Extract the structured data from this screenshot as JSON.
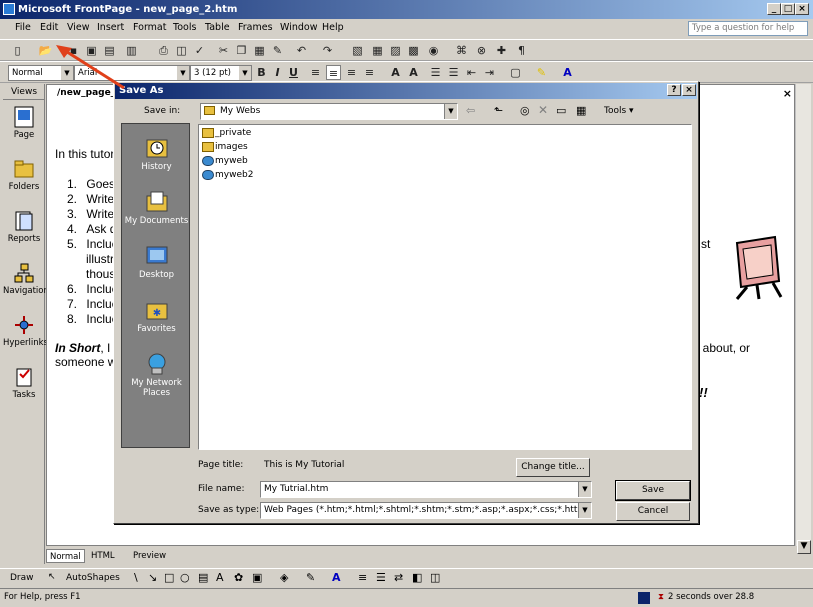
{
  "window": {
    "title": "Microsoft FrontPage - new_page_2.htm"
  },
  "menu": {
    "items": [
      "File",
      "Edit",
      "View",
      "Insert",
      "Format",
      "Tools",
      "Table",
      "Frames",
      "Window",
      "Help"
    ],
    "help_placeholder": "Type a question for help"
  },
  "format_toolbar": {
    "style": "Normal",
    "font": "Arial",
    "size": "3  (12 pt)"
  },
  "views": {
    "header": "Views",
    "items": [
      "Page",
      "Folders",
      "Reports",
      "Navigation",
      "Hyperlinks",
      "Tasks"
    ]
  },
  "document": {
    "tab": "new_page_2",
    "intro": "In this tutor",
    "list": [
      {
        "num": "1.",
        "text": "Goes"
      },
      {
        "num": "2.",
        "text": "Write"
      },
      {
        "num": "3.",
        "text": "Write"
      },
      {
        "num": "4.",
        "text": "Ask q"
      },
      {
        "num": "5.",
        "text": "Incluc"
      },
      {
        "num": "",
        "text": "illustr"
      },
      {
        "num": "",
        "text": "thous"
      },
      {
        "num": "6.",
        "text": "Incluc"
      },
      {
        "num": "7.",
        "text": "Incluc"
      },
      {
        "num": "8.",
        "text": "Incluc"
      }
    ],
    "in_short_bold": "In Short",
    "in_short_rest": ", I",
    "someone": "someone w",
    "right_st": "st",
    "right_line": "ng about, or",
    "right_bang": "!!"
  },
  "bottom_tabs": [
    "Normal",
    "HTML",
    "Preview"
  ],
  "drawing_toolbar": {
    "draw": "Draw",
    "autoshapes": "AutoShapes"
  },
  "status": {
    "left": "For Help, press F1",
    "right": "2 seconds over 28.8"
  },
  "dialog": {
    "title": "Save As",
    "save_in_label": "Save in:",
    "save_in_value": "My Webs",
    "tools_label": "Tools",
    "places": [
      "History",
      "My Documents",
      "Desktop",
      "Favorites",
      "My Network Places"
    ],
    "files": [
      {
        "name": "_private",
        "kind": "folder"
      },
      {
        "name": "images",
        "kind": "folder"
      },
      {
        "name": "myweb",
        "kind": "web"
      },
      {
        "name": "myweb2",
        "kind": "web"
      }
    ],
    "page_title_label": "Page title:",
    "page_title_value": "This is My Tutorial",
    "change_title_button": "Change title...",
    "file_name_label": "File name:",
    "file_name_value": "My Tutrial.htm",
    "save_as_type_label": "Save as type:",
    "save_as_type_value": "Web Pages (*.htm;*.html;*.shtml;*.shtm;*.stm;*.asp;*.aspx;*.css;*.htt;*.i",
    "save_button": "Save",
    "cancel_button": "Cancel"
  },
  "colors": {
    "titlebar": "#0a246a",
    "annotation_arrow": "#e0401a"
  }
}
